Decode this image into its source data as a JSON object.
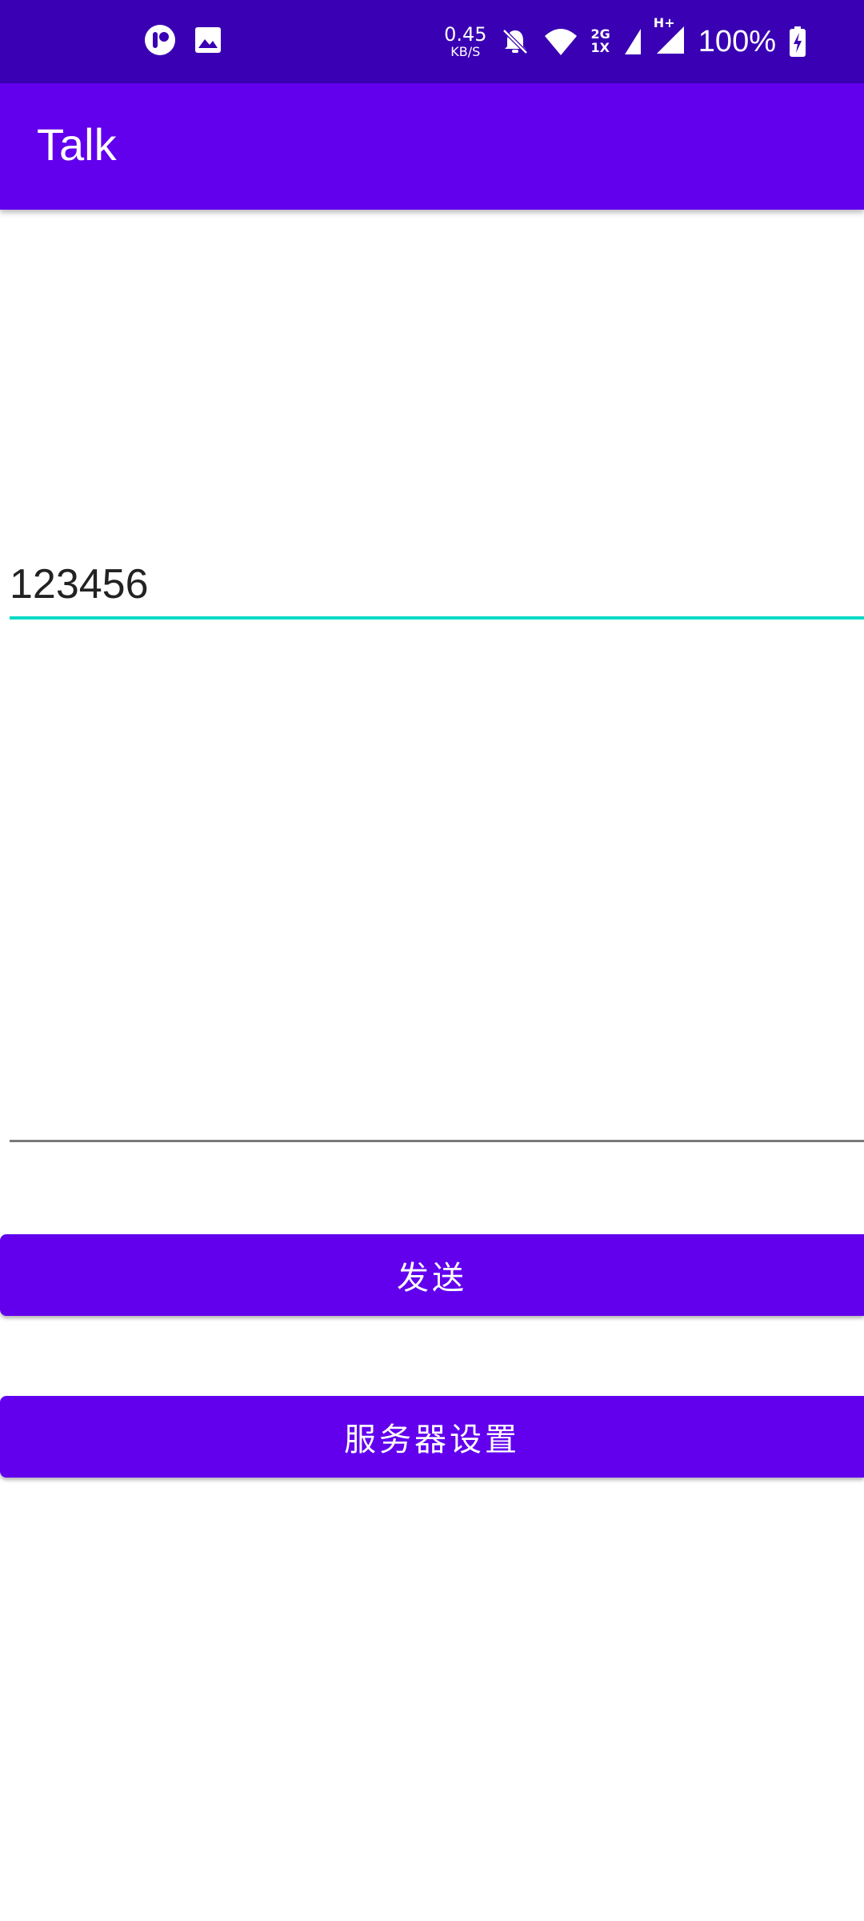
{
  "status_bar": {
    "net_speed_value": "0.45",
    "net_speed_unit": "KB/S",
    "net_type_top": "2G",
    "net_type_bottom": "1X",
    "data_type": "H+",
    "battery": "100%",
    "icons": [
      "app-notification-icon",
      "image-icon",
      "bell-off-icon",
      "wifi-icon",
      "signal-icon",
      "signal-icon",
      "battery-charging-icon"
    ]
  },
  "app_bar": {
    "title": "Talk"
  },
  "message_input": {
    "value": "123456"
  },
  "multiline_input": {
    "value": ""
  },
  "buttons": {
    "send_label": "发送",
    "server_settings_label": "服务器设置"
  },
  "colors": {
    "status_bar": "#3a00b3",
    "primary": "#6200ee",
    "accent": "#03dac5"
  }
}
